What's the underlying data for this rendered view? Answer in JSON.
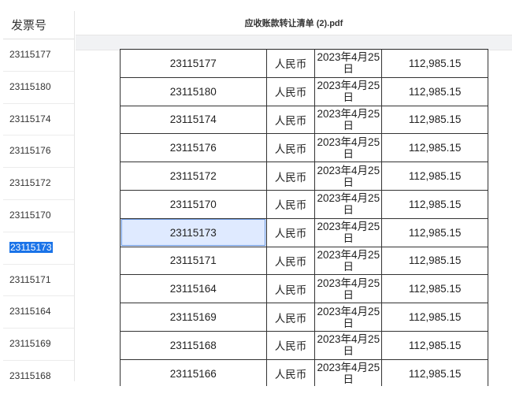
{
  "sheet": {
    "header": "发票号",
    "rows": [
      "23115177",
      "23115180",
      "23115174",
      "23115176",
      "23115172",
      "23115170",
      "23115173",
      "23115171",
      "23115164",
      "23115169",
      "23115168"
    ],
    "selected_index": 6
  },
  "viewer": {
    "title": "应收账款转让清单 (2).pdf"
  },
  "table": {
    "rows": [
      {
        "invoice": "23115177",
        "currency": "人民币",
        "date_line1": "2023年4月25",
        "date_line2": "日",
        "amount": "112,985.15"
      },
      {
        "invoice": "23115180",
        "currency": "人民币",
        "date_line1": "2023年4月25",
        "date_line2": "日",
        "amount": "112,985.15"
      },
      {
        "invoice": "23115174",
        "currency": "人民币",
        "date_line1": "2023年4月25",
        "date_line2": "日",
        "amount": "112,985.15"
      },
      {
        "invoice": "23115176",
        "currency": "人民币",
        "date_line1": "2023年4月25",
        "date_line2": "日",
        "amount": "112,985.15"
      },
      {
        "invoice": "23115172",
        "currency": "人民币",
        "date_line1": "2023年4月25",
        "date_line2": "日",
        "amount": "112,985.15"
      },
      {
        "invoice": "23115170",
        "currency": "人民币",
        "date_line1": "2023年4月25",
        "date_line2": "日",
        "amount": "112,985.15"
      },
      {
        "invoice": "23115173",
        "currency": "人民币",
        "date_line1": "2023年4月25",
        "date_line2": "日",
        "amount": "112,985.15"
      },
      {
        "invoice": "23115171",
        "currency": "人民币",
        "date_line1": "2023年4月25",
        "date_line2": "日",
        "amount": "112,985.15"
      },
      {
        "invoice": "23115164",
        "currency": "人民币",
        "date_line1": "2023年4月25",
        "date_line2": "日",
        "amount": "112,985.15"
      },
      {
        "invoice": "23115169",
        "currency": "人民币",
        "date_line1": "2023年4月25",
        "date_line2": "日",
        "amount": "112,985.15"
      },
      {
        "invoice": "23115168",
        "currency": "人民币",
        "date_line1": "2023年4月25",
        "date_line2": "日",
        "amount": "112,985.15"
      },
      {
        "invoice": "23115166",
        "currency": "人民币",
        "date_line1": "2023年4月25",
        "date_line2": "日",
        "amount": "112,985.15"
      }
    ],
    "selected_index": 6
  }
}
